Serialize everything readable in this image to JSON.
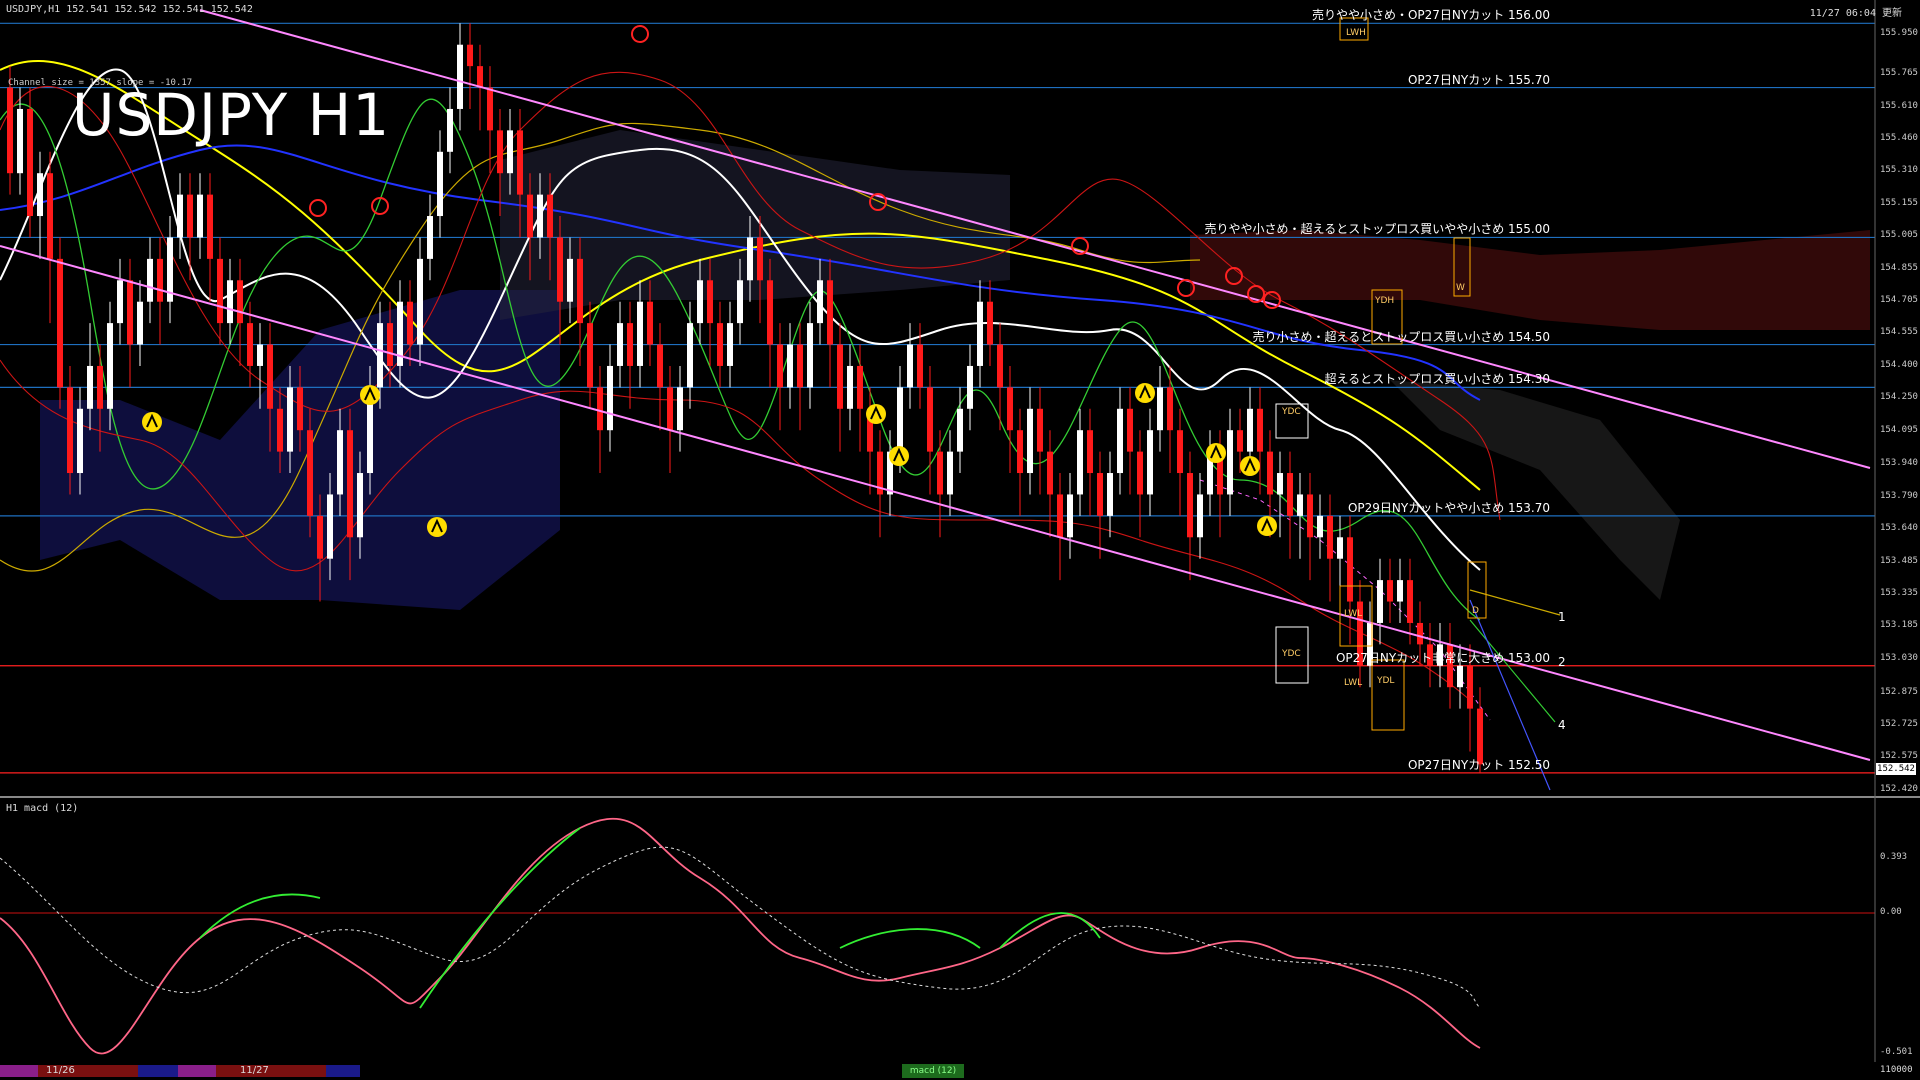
{
  "header": {
    "symbol_info": "USDJPY,H1  152.541 152.542 152.541 152.542",
    "datetime": "11/27 06:04 更新",
    "channel_info": "Channel size = 1357  slope = -10.17",
    "title": "USDJPY H1"
  },
  "levels": [
    {
      "text": "売りやや小さめ・OP27日NYカット 156.00",
      "price": 156.0
    },
    {
      "text": "OP27日NYカット 155.70",
      "price": 155.7
    },
    {
      "text": "売りやや小さめ・超えるとストップロス買いやや小さめ 155.00",
      "price": 155.0
    },
    {
      "text": "売り小さめ・超えるとストップロス買い小さめ 154.50",
      "price": 154.5
    },
    {
      "text": "超えるとストップロス買い小さめ 154.30",
      "price": 154.3
    },
    {
      "text": "OP29日NYカットやや小さめ 153.70",
      "price": 153.7
    },
    {
      "text": "OP27日NYカット非常に大きめ 153.00",
      "price": 153.0
    },
    {
      "text": "OP27日NYカット 152.50",
      "price": 152.5
    }
  ],
  "box_labels": [
    "LWH",
    "YDH",
    "YDC",
    "YDC",
    "LWL",
    "YDL",
    "LWL",
    "D",
    "W"
  ],
  "line_numbers": [
    "1",
    "2",
    "4"
  ],
  "price_axis": [
    "155.950",
    "155.765",
    "155.610",
    "155.460",
    "155.310",
    "155.155",
    "155.005",
    "154.855",
    "154.705",
    "154.555",
    "154.400",
    "154.250",
    "154.095",
    "153.940",
    "153.790",
    "153.640",
    "153.485",
    "153.335",
    "153.185",
    "153.030",
    "152.875",
    "152.725",
    "152.575",
    "152.420"
  ],
  "current_price": "152.542",
  "macd": {
    "title": "H1  macd (12)",
    "axis": [
      "0.393",
      "0.00",
      "-0.501"
    ]
  },
  "bottom": {
    "dates": [
      "11/26",
      "11/27"
    ],
    "tag": "macd (12)",
    "right_value": "110000"
  },
  "colors": {
    "background": "#000000",
    "channel": "#ff88ff",
    "level_line": "#1e6fbf",
    "level_red": "#ff2020",
    "bull_candle": "#ffffff",
    "bear_candle": "#ff1a1a",
    "sma_yellow": "#ffff00",
    "sma_white": "#ffffff",
    "sma_blue": "#2233ff",
    "macd_up": "#33ee33",
    "macd_down": "#ff6688",
    "signal": "#dddddd"
  }
}
